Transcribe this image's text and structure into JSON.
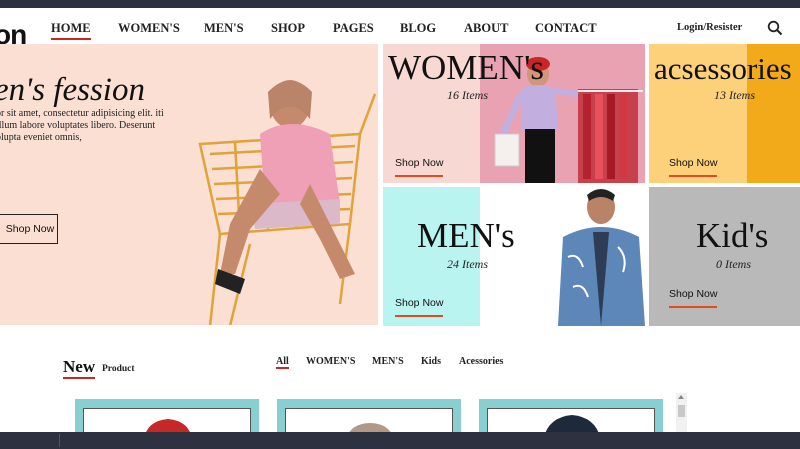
{
  "header": {
    "logo": "on",
    "nav": [
      "HOME",
      "WOMEN'S",
      "MEN'S",
      "SHOP",
      "PAGES",
      "BLOG",
      "ABOUT",
      "CONTACT"
    ],
    "login": "Login/Resister"
  },
  "hero": {
    "title": "en's fession",
    "text": "or sit amet, consectetur adipisicing elit. iti illum labore voluptates libero. Deserunt olupta eveniet omnis,",
    "button": "Shop Now"
  },
  "tiles": {
    "women": {
      "title": "WOMEN's",
      "count": "16 Items",
      "button": "Shop Now"
    },
    "accessories": {
      "title": "acsessories",
      "count": "13 Items",
      "button": "Shop Now"
    },
    "men": {
      "title": "MEN's",
      "count": "24 Items",
      "button": "Shop Now"
    },
    "kids": {
      "title": "Kid's",
      "count": "0 Items",
      "button": "Shop Now"
    }
  },
  "products": {
    "title": "New",
    "subtitle": "Product",
    "filters": [
      "All",
      "WOMEN'S",
      "MEN'S",
      "Kids",
      "Acessories"
    ]
  },
  "colors": {
    "dark_bar": "#2d3140",
    "accent_red": "#c62828",
    "button_underline": "#e04b24",
    "hero_bg": "#fadfd2",
    "women_bg": "#f8d8d3",
    "accessories_bg": "#fdd07a",
    "men_bg": "#b9f4f1",
    "kids_bg": "#b9b9b9",
    "card_bg": "#88cfd2"
  },
  "icons": [
    "search-icon",
    "scroll-up-arrow-icon"
  ]
}
